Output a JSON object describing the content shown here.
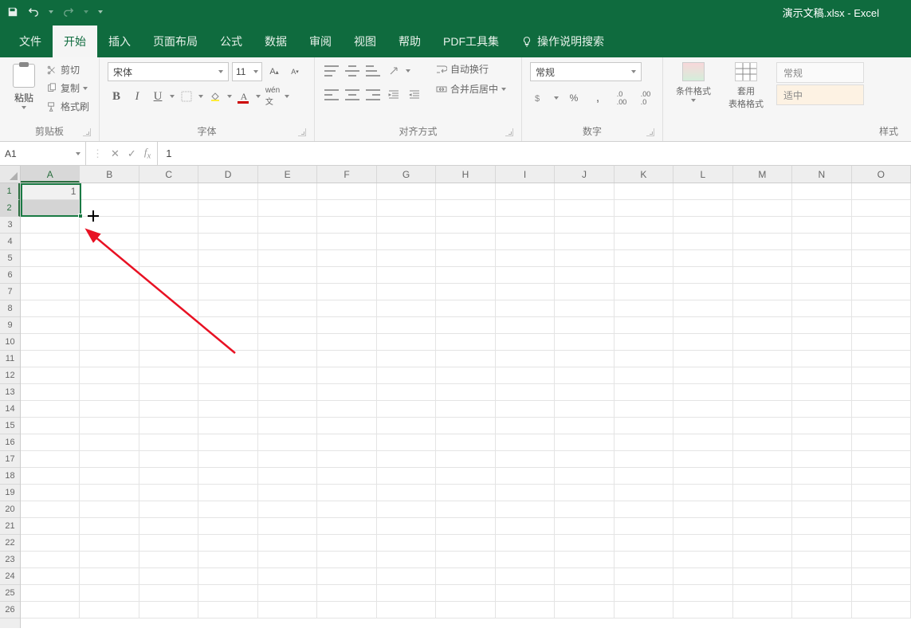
{
  "title": "演示文稿.xlsx  -  Excel",
  "tabs": {
    "file": "文件",
    "home": "开始",
    "insert": "插入",
    "layout": "页面布局",
    "formulas": "公式",
    "data": "数据",
    "review": "审阅",
    "view": "视图",
    "help": "帮助",
    "pdf": "PDF工具集",
    "tell": "操作说明搜索"
  },
  "clipboard": {
    "paste": "粘贴",
    "cut": "剪切",
    "copy": "复制",
    "painter": "格式刷",
    "group": "剪贴板"
  },
  "font": {
    "name": "宋体",
    "size": "11",
    "group": "字体"
  },
  "align": {
    "wrap": "自动换行",
    "merge": "合并后居中",
    "group": "对齐方式"
  },
  "number": {
    "format": "常规",
    "group": "数字"
  },
  "styles": {
    "conditional": "条件格式",
    "tableformat": "套用",
    "tableformat2": "表格格式",
    "normal": "常规",
    "good": "适中",
    "group": "样式"
  },
  "formula_bar": {
    "name_box": "A1",
    "value": "1"
  },
  "columns": [
    "A",
    "B",
    "C",
    "D",
    "E",
    "F",
    "G",
    "H",
    "I",
    "J",
    "K",
    "L",
    "M",
    "N",
    "O"
  ],
  "rows_count": 26,
  "cell_A1": "1"
}
